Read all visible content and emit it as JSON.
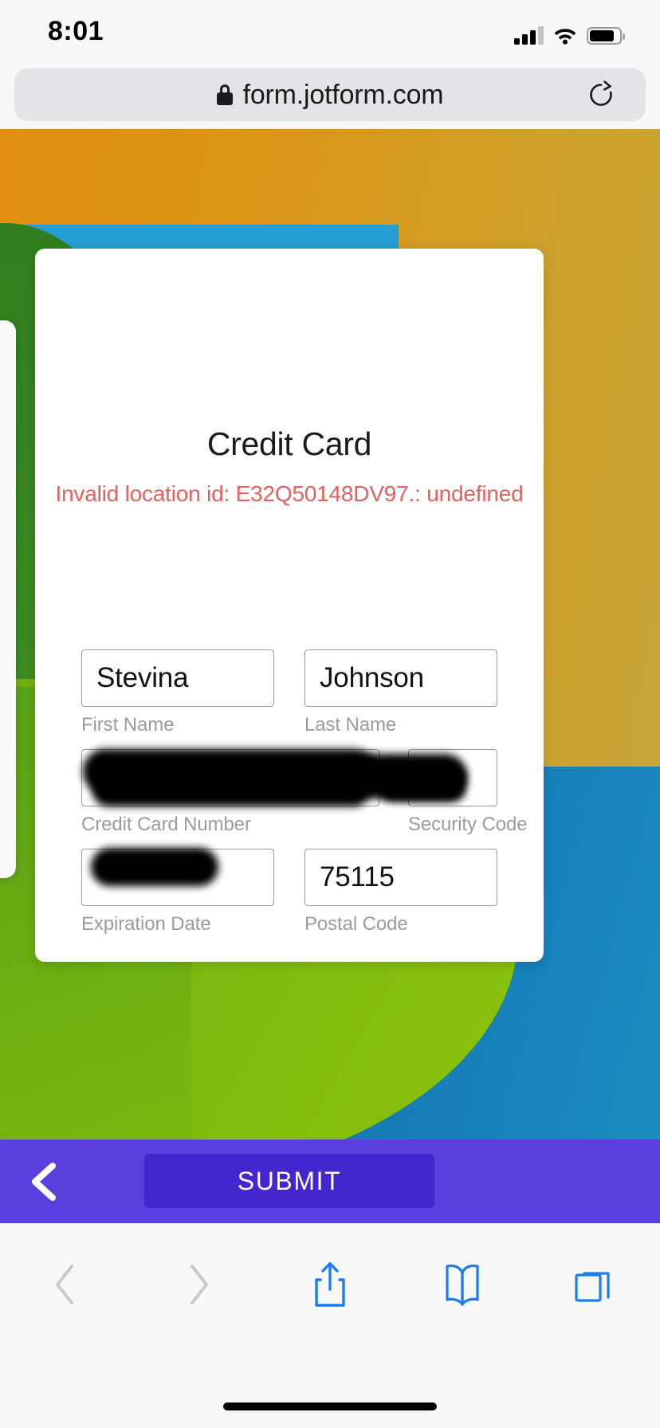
{
  "status_bar": {
    "time": "8:01",
    "signal_icon": "cellular-signal-icon",
    "wifi_icon": "wifi-icon",
    "battery_icon": "battery-icon"
  },
  "browser": {
    "url": "form.jotform.com",
    "lock_icon": "lock-icon",
    "reload_icon": "reload-icon"
  },
  "form": {
    "title": "Credit Card",
    "error_message": "Invalid location id: E32Q50148DV97.: undefined",
    "error_color": "#e2615c",
    "fields": [
      {
        "label": "First Name",
        "value": "Stevina",
        "redacted": false
      },
      {
        "label": "Last Name",
        "value": "Johnson",
        "redacted": false
      },
      {
        "label": "Credit Card Number",
        "value": "",
        "redacted": true
      },
      {
        "label": "Security Code",
        "value": "",
        "redacted": true
      },
      {
        "label": "Expiration Date",
        "value": "",
        "redacted": true
      },
      {
        "label": "Postal Code",
        "value": "75115",
        "redacted": false
      }
    ]
  },
  "submit_bar": {
    "back_icon": "chevron-left-icon",
    "submit_label": "SUBMIT",
    "bar_color": "#5b3ede",
    "button_color": "#4426cf"
  },
  "safari_toolbar": {
    "buttons": [
      {
        "name": "back-icon",
        "enabled": false
      },
      {
        "name": "forward-icon",
        "enabled": false
      },
      {
        "name": "share-icon",
        "enabled": true
      },
      {
        "name": "bookmarks-icon",
        "enabled": true
      },
      {
        "name": "tabs-icon",
        "enabled": true
      }
    ],
    "accent_color": "#1a7cf0",
    "disabled_color": "#c9c9ce"
  },
  "background": {
    "orange": "#dc9413",
    "green": "#3a8a22",
    "light_green": "#7ab70f",
    "blue": "#1474b4",
    "cyan": "#239fd4"
  }
}
